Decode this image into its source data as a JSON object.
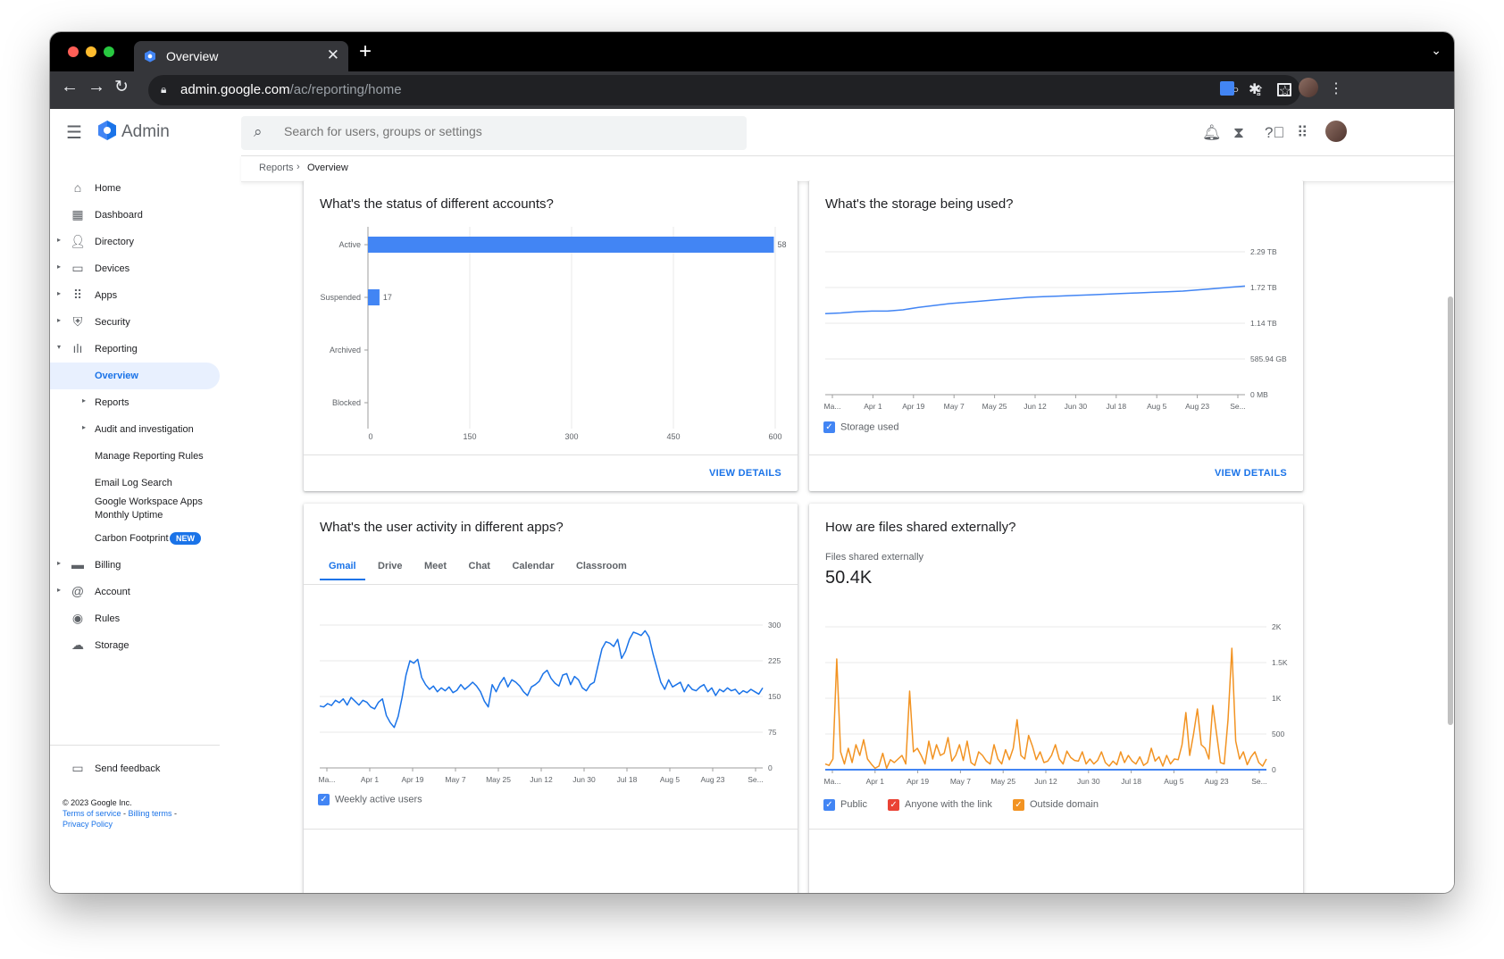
{
  "browser": {
    "tab_title": "Overview",
    "url_host": "admin.google.com",
    "url_path": "/ac/reporting/home"
  },
  "app": {
    "name": "Admin",
    "search_placeholder": "Search for users, groups or settings"
  },
  "breadcrumb": [
    "Reports",
    "Overview"
  ],
  "sidebar": {
    "items": [
      {
        "label": "Home",
        "icon": "home-icon",
        "arrow": false
      },
      {
        "label": "Dashboard",
        "icon": "dashboard-icon",
        "arrow": false
      },
      {
        "label": "Directory",
        "icon": "person-icon",
        "arrow": true
      },
      {
        "label": "Devices",
        "icon": "devices-icon",
        "arrow": true
      },
      {
        "label": "Apps",
        "icon": "apps-grid-icon",
        "arrow": true
      },
      {
        "label": "Security",
        "icon": "shield-icon",
        "arrow": true
      },
      {
        "label": "Reporting",
        "icon": "bar-chart-icon",
        "arrow": true,
        "expanded": true
      }
    ],
    "reporting_sub": [
      {
        "label": "Overview",
        "active": true
      },
      {
        "label": "Reports",
        "arrow": true
      },
      {
        "label": "Audit and investigation",
        "arrow": true
      },
      {
        "label": "Manage Reporting Rules"
      },
      {
        "label": "Email Log Search"
      },
      {
        "label": "Google Workspace Apps",
        "label2": "Monthly Uptime"
      },
      {
        "label": "Carbon Footprint",
        "badge": "NEW"
      }
    ],
    "items_bottom": [
      {
        "label": "Billing",
        "icon": "credit-card-icon",
        "arrow": true
      },
      {
        "label": "Account",
        "icon": "at-sign-icon",
        "arrow": true
      },
      {
        "label": "Rules",
        "icon": "rules-icon",
        "arrow": false
      },
      {
        "label": "Storage",
        "icon": "cloud-icon",
        "arrow": false
      }
    ],
    "feedback": "Send feedback",
    "copyright": "© 2023 Google Inc.",
    "links": [
      "Terms of service",
      "Billing terms",
      "Privacy Policy"
    ]
  },
  "cards": {
    "accounts": {
      "title": "What's the status of different accounts?",
      "action": "VIEW DETAILS"
    },
    "storage": {
      "title": "What's the storage being used?",
      "action": "VIEW DETAILS",
      "legend": "Storage used"
    },
    "activity": {
      "title": "What's the user activity in different apps?",
      "tabs": [
        "Gmail",
        "Drive",
        "Meet",
        "Chat",
        "Calendar",
        "Classroom"
      ],
      "selected_tab": "Gmail",
      "legend": "Weekly active users"
    },
    "sharing": {
      "title": "How are files shared externally?",
      "stat_label": "Files shared externally",
      "stat_value": "50.4K",
      "legend": [
        "Public",
        "Anyone with the link",
        "Outside domain"
      ]
    }
  },
  "colors": {
    "accent": "#1a73e8",
    "bar": "#4285f4",
    "orange": "#f29322",
    "red_check": "#ea4335"
  },
  "chart_data": [
    {
      "type": "bar",
      "orientation": "horizontal",
      "categories": [
        "Active",
        "Suspended",
        "Archived",
        "Blocked"
      ],
      "values": [
        598,
        17,
        0,
        0
      ],
      "data_labels": [
        "58",
        "17",
        "",
        ""
      ],
      "xlim": [
        0,
        600
      ],
      "xticks": [
        "0",
        "150",
        "300",
        "450",
        "600"
      ]
    },
    {
      "type": "line",
      "series": [
        {
          "name": "Storage used",
          "values": [
            1.3,
            1.31,
            1.33,
            1.34,
            1.34,
            1.36,
            1.4,
            1.43,
            1.46,
            1.48,
            1.5,
            1.52,
            1.54,
            1.56,
            1.57,
            1.58,
            1.59,
            1.6,
            1.61,
            1.62,
            1.63,
            1.64,
            1.65,
            1.66,
            1.68,
            1.7,
            1.72,
            1.74
          ]
        }
      ],
      "y_unit": "TB",
      "yticks": [
        "0 MB",
        "585.94 GB",
        "1.14 TB",
        "1.72 TB",
        "2.29 TB"
      ],
      "ylim": [
        0,
        2.29
      ],
      "xticks": [
        "Ma...",
        "Apr 1",
        "Apr 19",
        "May 7",
        "May 25",
        "Jun 12",
        "Jun 30",
        "Jul 18",
        "Aug 5",
        "Aug 23",
        "Se..."
      ]
    },
    {
      "type": "line",
      "series": [
        {
          "name": "Weekly active users",
          "values": [
            130,
            128,
            135,
            131,
            142,
            137,
            145,
            132,
            148,
            140,
            132,
            142,
            138,
            128,
            124,
            138,
            145,
            110,
            95,
            85,
            108,
            148,
            195,
            225,
            220,
            228,
            190,
            175,
            165,
            172,
            160,
            168,
            162,
            170,
            158,
            163,
            175,
            165,
            172,
            180,
            172,
            160,
            140,
            128,
            175,
            160,
            178,
            190,
            170,
            185,
            180,
            172,
            160,
            152,
            170,
            175,
            182,
            198,
            205,
            188,
            178,
            172,
            195,
            198,
            175,
            192,
            185,
            168,
            162,
            175,
            180,
            215,
            250,
            265,
            262,
            255,
            270,
            230,
            245,
            270,
            285,
            282,
            278,
            288,
            275,
            240,
            210,
            180,
            165,
            185,
            170,
            175,
            180,
            160,
            175,
            165,
            162,
            170,
            175,
            160,
            168,
            152,
            165,
            160,
            168,
            162,
            165,
            155,
            162,
            158,
            165,
            160,
            155,
            168
          ]
        }
      ],
      "ylim": [
        0,
        300
      ],
      "yticks": [
        "0",
        "75",
        "150",
        "225",
        "300"
      ],
      "xticks": [
        "Ma...",
        "Apr 1",
        "Apr 19",
        "May 7",
        "May 25",
        "Jun 12",
        "Jun 30",
        "Jul 18",
        "Aug 5",
        "Aug 23",
        "Se..."
      ]
    },
    {
      "type": "line",
      "series": [
        {
          "name": "Public",
          "values": [
            0,
            0,
            0,
            0,
            0,
            0,
            0,
            0,
            0,
            0,
            0,
            0,
            0,
            0,
            0,
            0,
            0,
            0,
            0,
            0,
            0,
            0,
            0,
            0,
            0,
            0,
            0,
            0,
            0,
            0,
            0,
            0,
            0,
            0,
            0,
            0,
            0,
            0,
            0,
            0,
            0,
            0,
            0,
            0,
            0,
            0,
            0,
            0,
            0,
            0,
            0,
            0,
            0,
            0,
            0,
            0,
            0,
            0,
            0,
            0,
            0,
            0,
            0,
            0,
            0,
            0,
            0,
            0,
            0,
            0,
            0,
            0,
            0,
            0,
            0,
            0,
            0,
            0,
            0,
            0,
            0,
            0,
            0,
            0,
            0,
            0,
            0,
            0,
            0,
            0,
            0,
            0,
            0,
            0,
            0,
            0,
            0,
            0,
            0,
            0,
            0,
            0,
            0,
            0,
            0,
            0,
            0,
            0,
            0,
            0,
            0,
            0,
            0,
            0,
            0,
            0
          ]
        },
        {
          "name": "Anyone with the link",
          "values": [
            0,
            0,
            0,
            0,
            0,
            0,
            0,
            0,
            0,
            0,
            0,
            0,
            0,
            0,
            0,
            0,
            0,
            0,
            0,
            0,
            0,
            0,
            0,
            0,
            0,
            0,
            0,
            0,
            0,
            0,
            0,
            0,
            0,
            0,
            0,
            0,
            0,
            0,
            0,
            0,
            0,
            0,
            0,
            0,
            0,
            0,
            0,
            0,
            0,
            0,
            0,
            0,
            0,
            0,
            0,
            0,
            0,
            0,
            0,
            0,
            0,
            0,
            0,
            0,
            0,
            0,
            0,
            0,
            0,
            0,
            0,
            0,
            0,
            0,
            0,
            0,
            0,
            0,
            0,
            0,
            0,
            0,
            0,
            0,
            0,
            0,
            0,
            0,
            0,
            0,
            0,
            0,
            0,
            0,
            0,
            0,
            0,
            0,
            0,
            0,
            0,
            0,
            0,
            0,
            0,
            0,
            0,
            0,
            0,
            0,
            0,
            0,
            0,
            0,
            0,
            0
          ]
        },
        {
          "name": "Outside domain",
          "values": [
            80,
            60,
            150,
            1550,
            250,
            80,
            300,
            100,
            350,
            200,
            420,
            150,
            80,
            20,
            50,
            230,
            20,
            140,
            100,
            150,
            200,
            80,
            1100,
            250,
            300,
            200,
            80,
            400,
            150,
            350,
            200,
            230,
            450,
            120,
            200,
            350,
            130,
            400,
            100,
            60,
            250,
            200,
            120,
            80,
            350,
            150,
            80,
            280,
            140,
            300,
            700,
            200,
            150,
            480,
            330,
            140,
            250,
            100,
            120,
            200,
            350,
            150,
            80,
            260,
            170,
            130,
            120,
            250,
            80,
            150,
            80,
            130,
            250,
            100,
            50,
            120,
            70,
            250,
            100,
            200,
            120,
            80,
            180,
            60,
            100,
            300,
            120,
            180,
            50,
            200,
            80,
            150,
            140,
            350,
            800,
            200,
            500,
            850,
            350,
            300,
            150,
            900,
            500,
            100,
            80,
            700,
            1700,
            400,
            150,
            250,
            70,
            180,
            250,
            100,
            50,
            150
          ]
        }
      ],
      "ylim": [
        0,
        2000
      ],
      "yticks": [
        "0",
        "500",
        "1K",
        "1.5K",
        "2K"
      ],
      "xticks": [
        "Ma...",
        "Apr 1",
        "Apr 19",
        "May 7",
        "May 25",
        "Jun 12",
        "Jun 30",
        "Jul 18",
        "Aug 5",
        "Aug 23",
        "Se..."
      ]
    }
  ]
}
